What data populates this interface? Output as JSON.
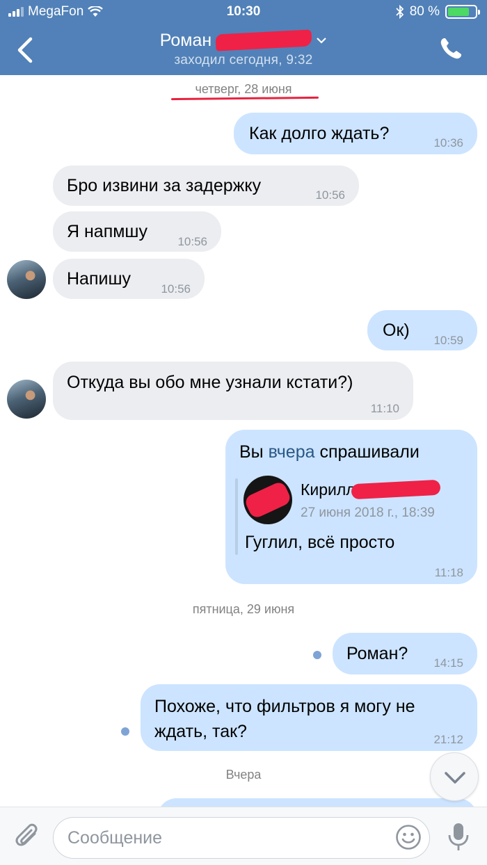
{
  "status_bar": {
    "carrier": "MegaFon",
    "time": "10:30",
    "battery": "80 %",
    "battery_level": 0.8
  },
  "header": {
    "name": "Роман",
    "last_seen": "заходил сегодня, 9:32",
    "icons": [
      "back-chevron-icon",
      "chevron-down-icon",
      "phone-icon"
    ]
  },
  "dates": {
    "thursday": "четверг, 28 июня",
    "friday": "пятница, 29 июня",
    "yesterday": "Вчера"
  },
  "messages": [
    {
      "dir": "out",
      "text": "Как долго ждать?",
      "time": "10:36"
    },
    {
      "dir": "in",
      "text": "Бро извини за задержку",
      "time": "10:56"
    },
    {
      "dir": "in",
      "text": "Я напмшу",
      "time": "10:56"
    },
    {
      "dir": "in",
      "text": "Напишу",
      "time": "10:56"
    },
    {
      "dir": "out",
      "text": "Ок)",
      "time": "10:59"
    },
    {
      "dir": "in",
      "text": "Откуда вы обо мне узнали кстати?)",
      "time": "11:10"
    },
    {
      "dir": "out",
      "text_before": "Вы",
      "link": "вчера",
      "text_after": "спрашивали",
      "time": "11:18",
      "forwarded": {
        "author": "Кирилл",
        "date": "27 июня 2018 г., 18:39",
        "text": "Гуглил, всё просто"
      }
    },
    {
      "dir": "out",
      "text": "Роман?",
      "time": "14:15"
    },
    {
      "dir": "out",
      "text_line1": "Похоже, что фильтров я могу не",
      "text_line2": "ждать, так?",
      "time": "21:12"
    }
  ],
  "composer": {
    "placeholder": "Сообщение",
    "icons": [
      "paperclip-icon",
      "smile-icon",
      "microphone-icon",
      "chevron-down-icon"
    ]
  },
  "colors": {
    "header": "#5181b8",
    "incoming_bubble": "#ecedf1",
    "outgoing_bubble": "#cce4ff",
    "link": "#2a5885",
    "redaction": "#ef2147"
  }
}
